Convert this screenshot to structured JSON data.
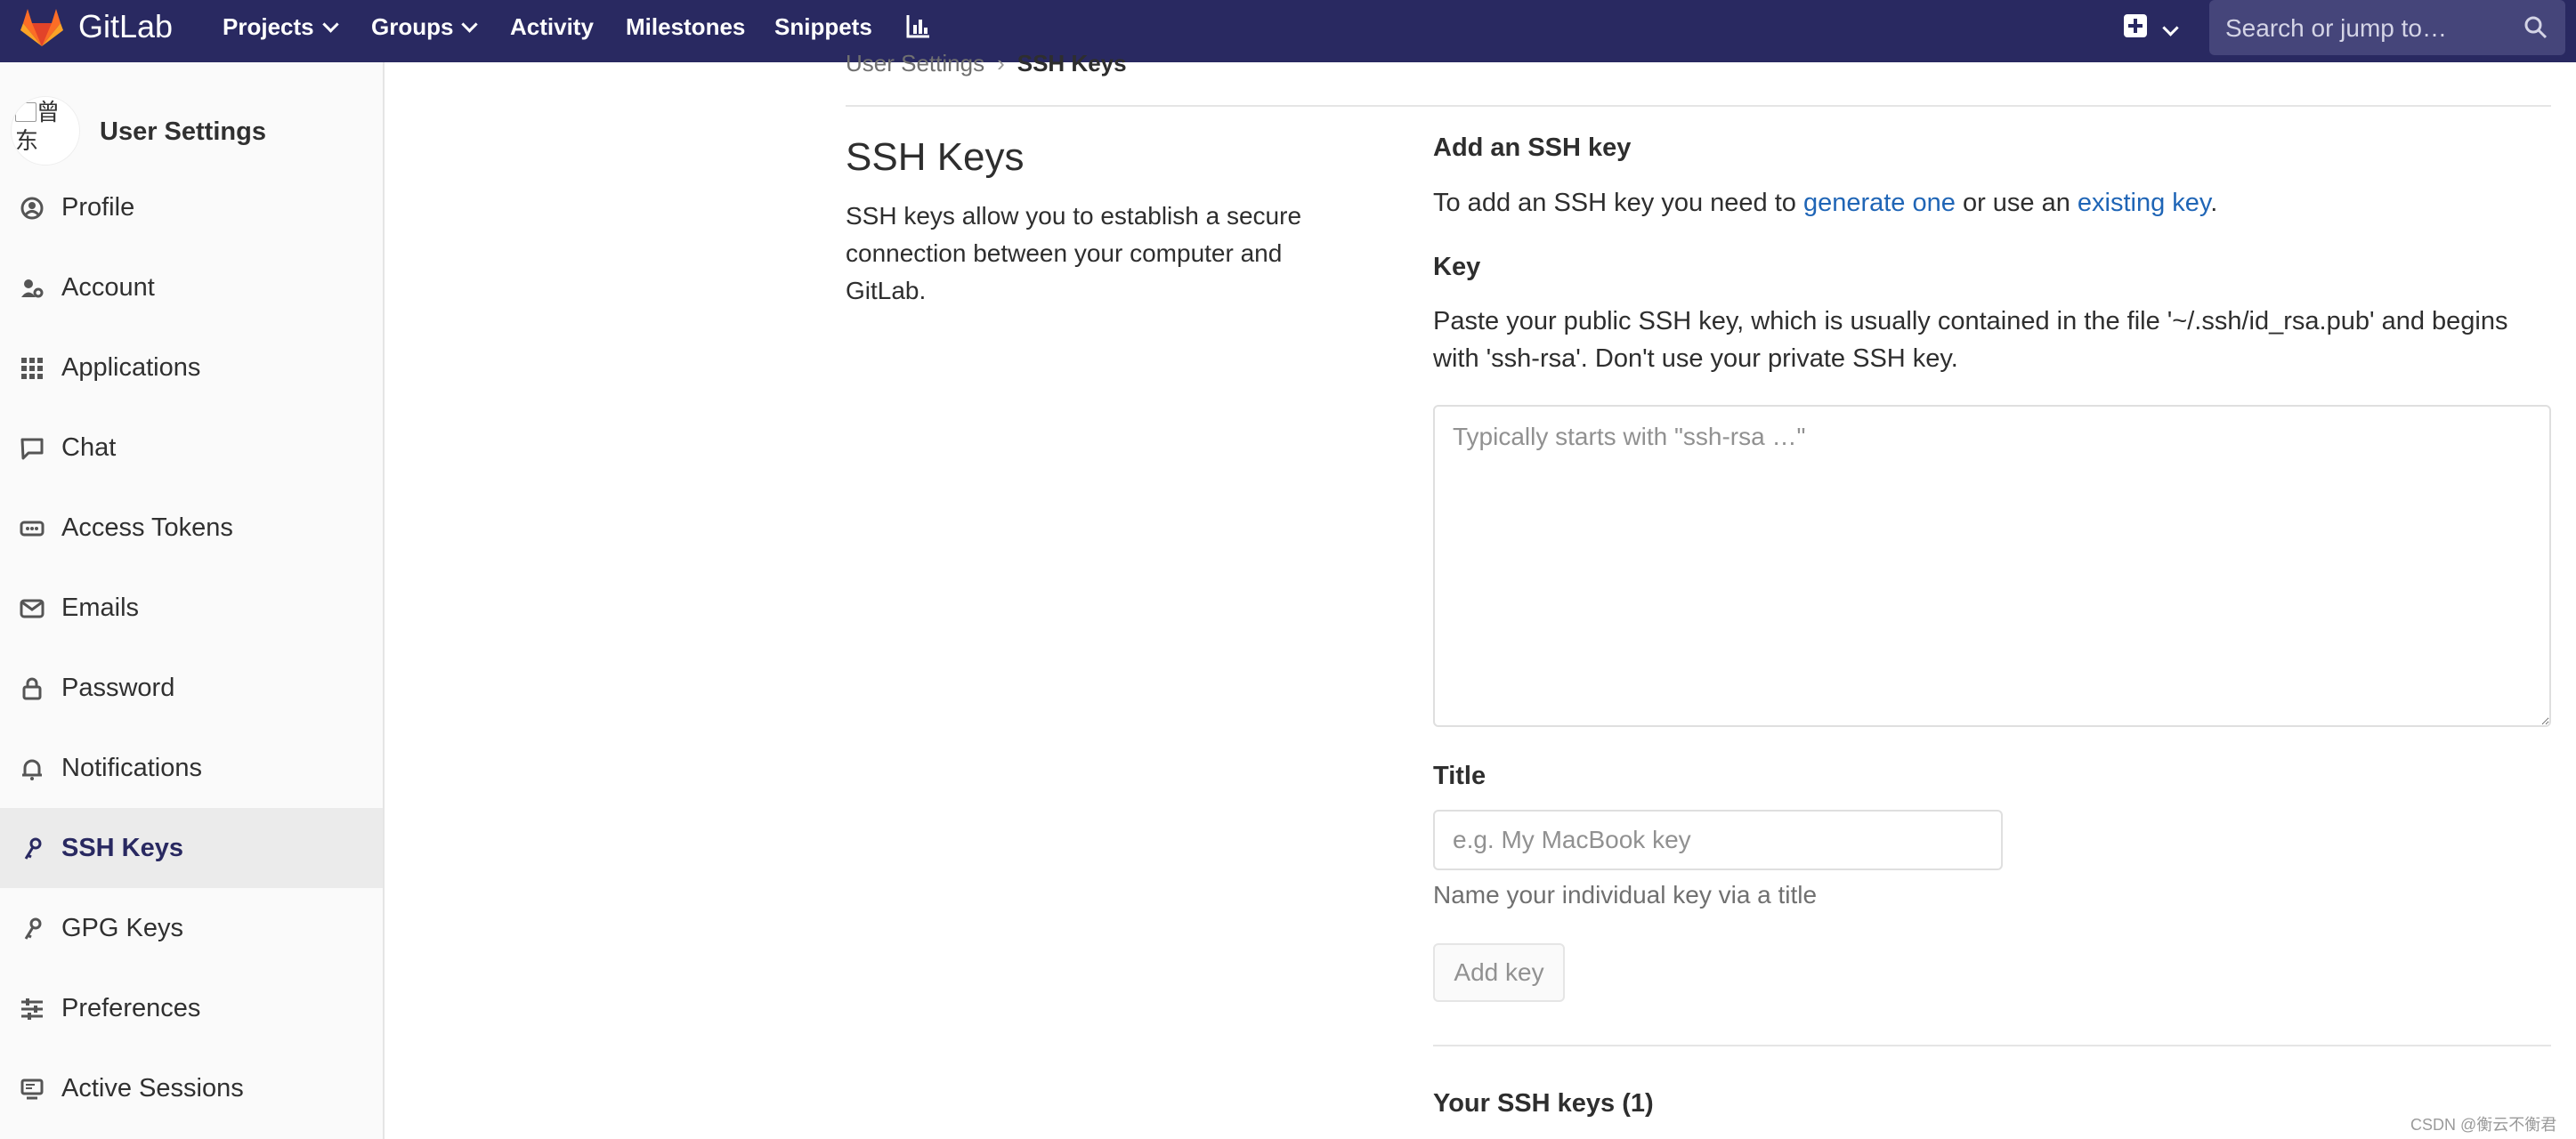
{
  "navbar": {
    "brand": "GitLab",
    "links": {
      "projects": "Projects",
      "groups": "Groups",
      "activity": "Activity",
      "milestones": "Milestones",
      "snippets": "Snippets"
    },
    "search_placeholder": "Search or jump to…",
    "icons": [
      "gitlab-logo",
      "chart-icon",
      "plus-square-icon",
      "chevron-down-icon",
      "search-icon"
    ],
    "colors": {
      "navbar_bg": "#292961",
      "logo_orange": "#e24329"
    }
  },
  "sidebar": {
    "title": "User Settings",
    "avatar_alt": "曾东",
    "items": [
      {
        "label": "Profile",
        "icon": "profile-icon"
      },
      {
        "label": "Account",
        "icon": "account-icon"
      },
      {
        "label": "Applications",
        "icon": "applications-icon"
      },
      {
        "label": "Chat",
        "icon": "chat-icon"
      },
      {
        "label": "Access Tokens",
        "icon": "token-icon"
      },
      {
        "label": "Emails",
        "icon": "mail-icon"
      },
      {
        "label": "Password",
        "icon": "lock-icon"
      },
      {
        "label": "Notifications",
        "icon": "bell-icon"
      },
      {
        "label": "SSH Keys",
        "icon": "key-icon",
        "active": true
      },
      {
        "label": "GPG Keys",
        "icon": "key-icon"
      },
      {
        "label": "Preferences",
        "icon": "preferences-icon"
      },
      {
        "label": "Active Sessions",
        "icon": "monitor-icon"
      }
    ]
  },
  "breadcrumb": {
    "parent": "User Settings",
    "current": "SSH Keys"
  },
  "main": {
    "title": "SSH Keys",
    "description": "SSH keys allow you to establish a secure connection between your computer and GitLab.",
    "add_heading": "Add an SSH key",
    "add_text_1": "To add an SSH key you need to ",
    "link_generate": "generate one",
    "add_text_2": " or use an ",
    "link_existing": "existing key",
    "add_text_3": ".",
    "key_label": "Key",
    "key_help": "Paste your public SSH key, which is usually contained in the file '~/.ssh/id_rsa.pub' and begins with 'ssh-rsa'. Don't use your private SSH key.",
    "key_placeholder": "Typically starts with \"ssh-rsa …\"",
    "title_label": "Title",
    "title_placeholder": "e.g. My MacBook key",
    "title_help": "Name your individual key via a title",
    "add_button": "Add key",
    "your_keys_heading": "Your SSH keys (1)"
  },
  "watermark": "CSDN @衡云不衡君",
  "colors": {
    "link": "#1f65b6",
    "active_item_bg": "#ebebeb"
  }
}
